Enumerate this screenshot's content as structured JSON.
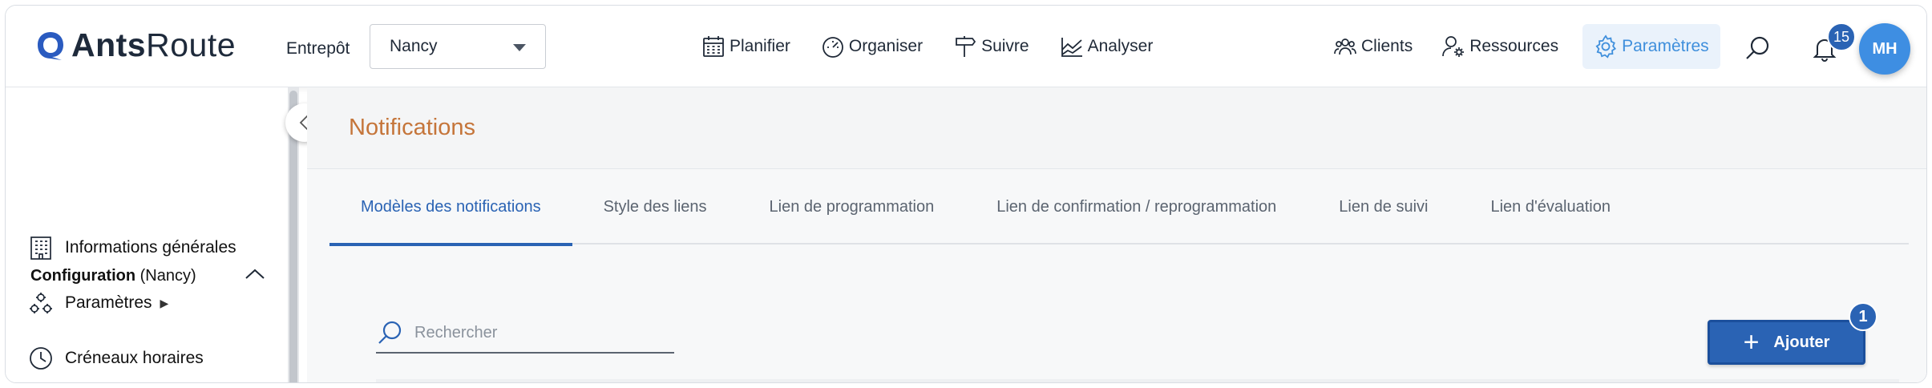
{
  "header": {
    "logo": {
      "bold": "Ants",
      "regular": "Route"
    },
    "warehouse_label": "Entrepôt",
    "warehouse_value": "Nancy",
    "nav_main": [
      {
        "label": "Planifier",
        "icon": "calendar-icon"
      },
      {
        "label": "Organiser",
        "icon": "gauge-icon"
      },
      {
        "label": "Suivre",
        "icon": "signpost-icon"
      },
      {
        "label": "Analyser",
        "icon": "chart-icon"
      }
    ],
    "nav_right": [
      {
        "label": "Clients",
        "icon": "users-icon"
      },
      {
        "label": "Ressources",
        "icon": "user-gear-icon"
      },
      {
        "label": "Paramètres",
        "icon": "gear-icon",
        "active": true
      }
    ],
    "notifications_count": "15",
    "avatar_initials": "MH"
  },
  "sidebar": {
    "config_title_bold": "Configuration",
    "config_title_rest": " (Nancy)",
    "items": [
      {
        "label": "Informations générales",
        "icon": "building-icon"
      },
      {
        "label": "Paramètres",
        "icon": "settings-cluster-icon",
        "submenu": "▶"
      },
      {
        "label": "Créneaux horaires",
        "icon": "clock-icon"
      }
    ]
  },
  "main": {
    "page_title": "Notifications",
    "tabs": [
      {
        "label": "Modèles des notifications",
        "active": true
      },
      {
        "label": "Style des liens"
      },
      {
        "label": "Lien de programmation"
      },
      {
        "label": "Lien de confirmation / reprogrammation"
      },
      {
        "label": "Lien de suivi"
      },
      {
        "label": "Lien d'évaluation"
      }
    ],
    "search_placeholder": "Rechercher",
    "add_button_label": "Ajouter",
    "add_button_badge": "1"
  },
  "colors": {
    "brand_blue": "#2a63b4",
    "active_nav": "#3f8fdc",
    "page_title": "#c5753a",
    "avatar": "#3e8ee2"
  }
}
